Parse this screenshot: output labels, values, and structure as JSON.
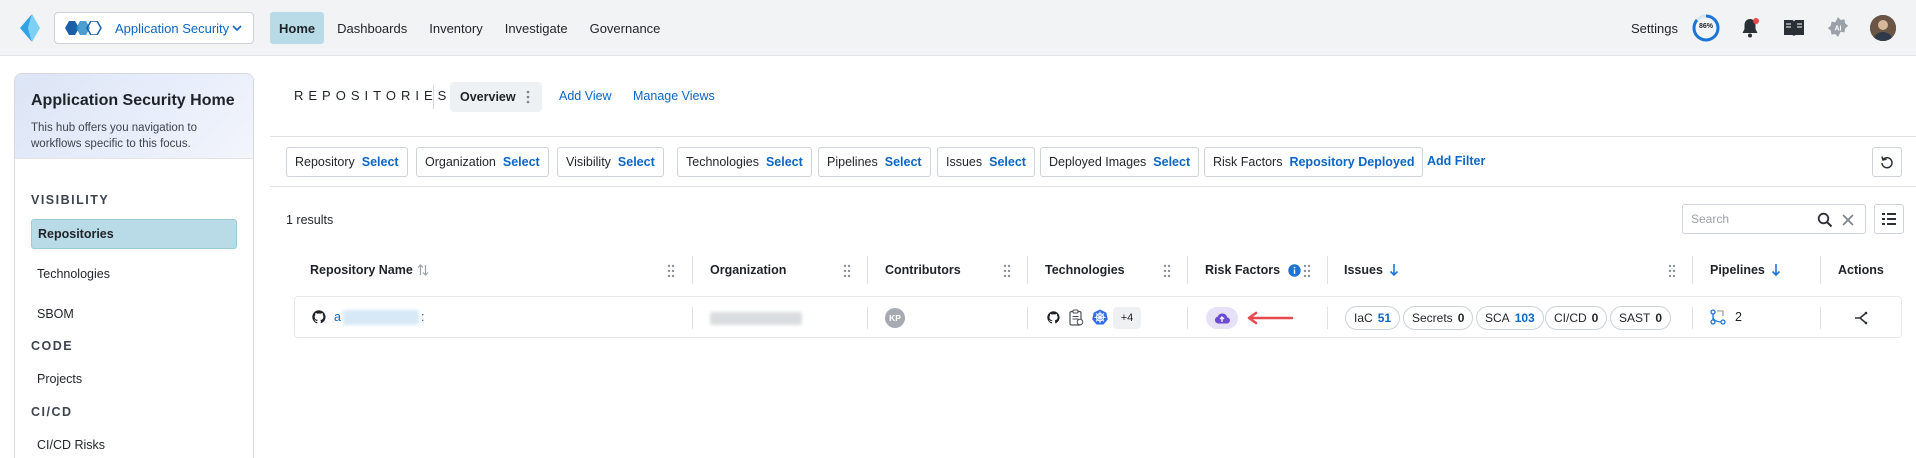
{
  "topbar": {
    "app_switcher_label": "Application Security",
    "nav": [
      "Home",
      "Dashboards",
      "Inventory",
      "Investigate",
      "Governance"
    ],
    "active_nav": "Home",
    "settings_label": "Settings",
    "progress_text": "86%",
    "progress_value": 0.86,
    "ai_label": "AI",
    "colors": {
      "accent": "#0c66c4",
      "active_bg": "#b9dbe8",
      "notification_dot": "#e5484d"
    }
  },
  "sidebar": {
    "title": "Application Security Home",
    "description": "This hub offers you navigation to workflows specific to this focus.",
    "sections": [
      {
        "label": "VISIBILITY",
        "items": [
          "Repositories",
          "Technologies",
          "SBOM"
        ]
      },
      {
        "label": "CODE",
        "items": [
          "Projects"
        ]
      },
      {
        "label": "CI/CD",
        "items": [
          "CI/CD Risks"
        ]
      }
    ],
    "active_item": "Repositories"
  },
  "page": {
    "title": "REPOSITORIES",
    "active_view": "Overview",
    "add_view": "Add View",
    "manage_views": "Manage Views"
  },
  "filters": [
    {
      "key": "Repository",
      "value": "Select"
    },
    {
      "key": "Organization",
      "value": "Select"
    },
    {
      "key": "Visibility",
      "value": "Select"
    },
    {
      "key": "Technologies",
      "value": "Select"
    },
    {
      "key": "Pipelines",
      "value": "Select"
    },
    {
      "key": "Issues",
      "value": "Select"
    },
    {
      "key": "Deployed Images",
      "value": "Select"
    },
    {
      "key": "Risk Factors",
      "value": "Repository Deployed"
    }
  ],
  "add_filter": "Add Filter",
  "results_text": "1 results",
  "search": {
    "placeholder": "Search"
  },
  "table": {
    "columns": [
      "Repository Name",
      "Organization",
      "Contributors",
      "Technologies",
      "Risk Factors",
      "Issues",
      "Pipelines",
      "Actions"
    ],
    "row": {
      "repo_name": "a",
      "repo_suffix": ":",
      "contributor_initials": "KP",
      "tech_more": "+4",
      "issues": [
        {
          "label": "IaC",
          "count": "51",
          "highlight": true
        },
        {
          "label": "Secrets",
          "count": "0",
          "highlight": false
        },
        {
          "label": "SCA",
          "count": "103",
          "highlight": true
        },
        {
          "label": "CI/CD",
          "count": "0",
          "highlight": false
        },
        {
          "label": "SAST",
          "count": "0",
          "highlight": false
        }
      ],
      "pipelines_count": "2"
    }
  }
}
